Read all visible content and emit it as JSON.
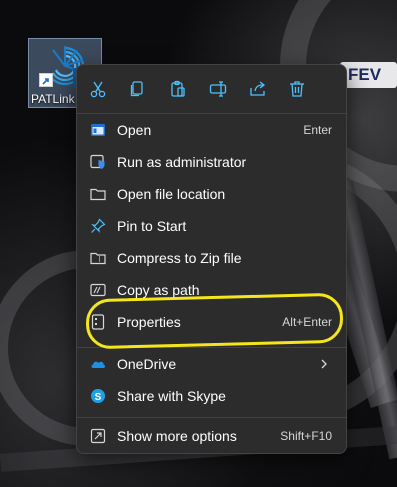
{
  "desktop": {
    "shortcut_label": "PATLink",
    "background_badge": "FEV"
  },
  "toolbar": {
    "buttons": [
      {
        "name": "cut-icon",
        "icon": "scissors"
      },
      {
        "name": "copy-icon",
        "icon": "copy"
      },
      {
        "name": "paste-icon",
        "icon": "clipboard"
      },
      {
        "name": "rename-icon",
        "icon": "rename"
      },
      {
        "name": "share-icon",
        "icon": "share"
      },
      {
        "name": "delete-icon",
        "icon": "trash"
      }
    ]
  },
  "menu": {
    "items": [
      {
        "label": "Open",
        "shortcut": "Enter",
        "icon": "window-icon"
      },
      {
        "label": "Run as administrator",
        "shortcut": "",
        "icon": "shield-icon"
      },
      {
        "label": "Open file location",
        "shortcut": "",
        "icon": "folder-icon"
      },
      {
        "label": "Pin to Start",
        "shortcut": "",
        "icon": "pin-icon"
      },
      {
        "label": "Compress to Zip file",
        "shortcut": "",
        "icon": "zip-folder-icon"
      },
      {
        "label": "Copy as path",
        "shortcut": "",
        "icon": "path-icon"
      },
      {
        "label": "Properties",
        "shortcut": "Alt+Enter",
        "icon": "properties-icon"
      },
      {
        "label": "OneDrive",
        "shortcut": "",
        "icon": "onedrive-icon",
        "submenu": true
      },
      {
        "label": "Share with Skype",
        "shortcut": "",
        "icon": "skype-icon"
      },
      {
        "label": "Show more options",
        "shortcut": "Shift+F10",
        "icon": "more-options-icon"
      }
    ]
  },
  "annotation": {
    "color": "#f4e61a",
    "target": "Properties"
  },
  "colors": {
    "menu_bg": "#2c2c2c",
    "menu_border": "#434343",
    "accent": "#4cc2ff",
    "text": "#ffffff"
  }
}
